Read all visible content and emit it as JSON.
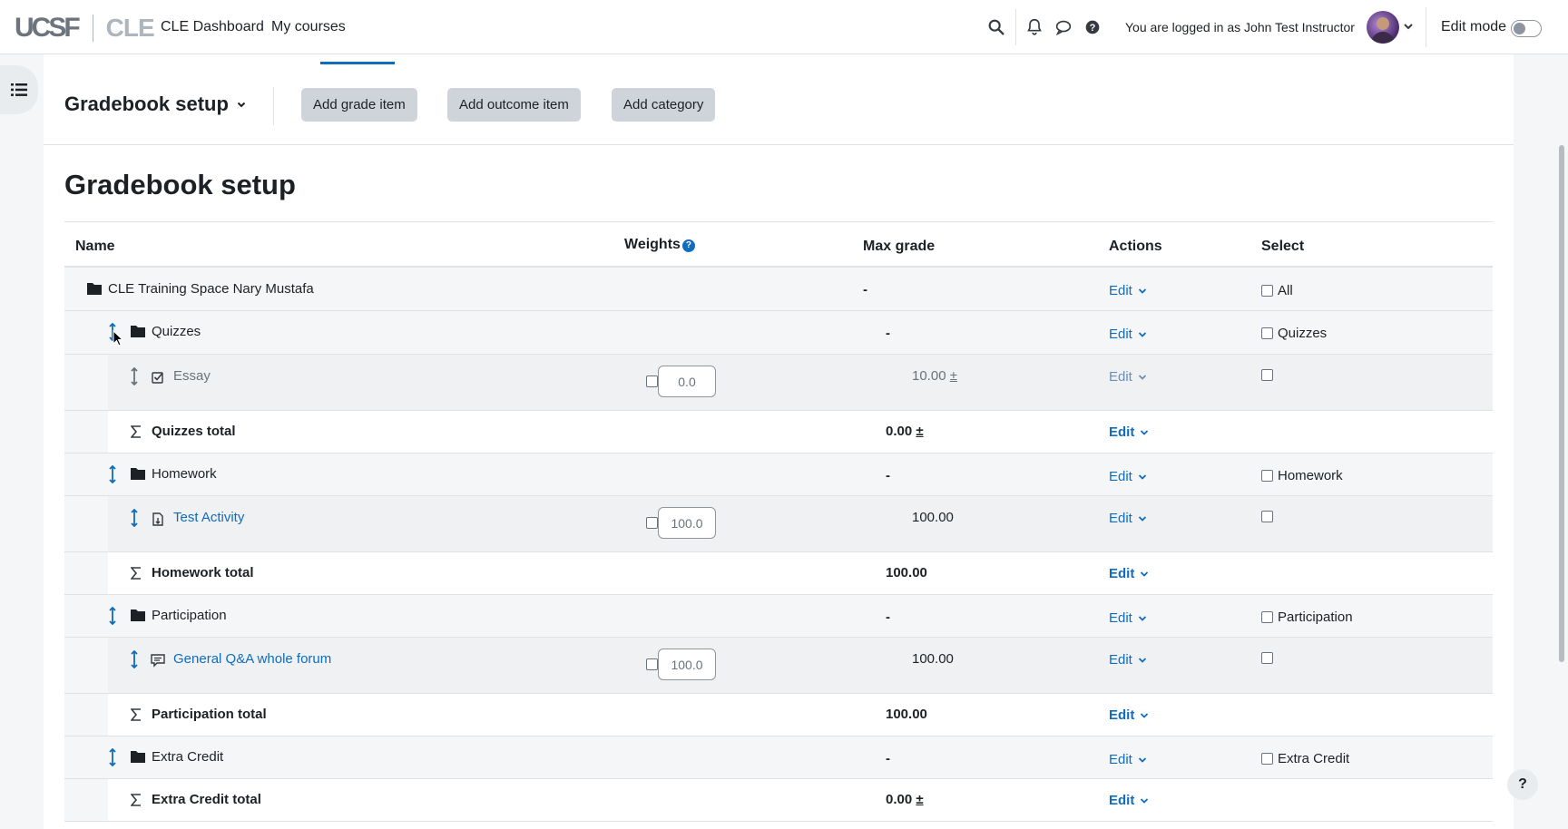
{
  "brand": {
    "ucsf": "UCSF",
    "cle": "CLE"
  },
  "nav": {
    "dashboard": "CLE Dashboard",
    "mycourses": "My courses"
  },
  "user": {
    "login_text": "You are logged in as John Test Instructor"
  },
  "editmode": {
    "label": "Edit mode"
  },
  "toolbar": {
    "select_label": "Gradebook setup",
    "add_grade_item": "Add grade item",
    "add_outcome_item": "Add outcome item",
    "add_category": "Add category"
  },
  "page_title": "Gradebook setup",
  "table": {
    "headers": {
      "name": "Name",
      "weights": "Weights",
      "max_grade": "Max grade",
      "actions": "Actions",
      "select": "Select"
    },
    "edit_label": "Edit",
    "course": {
      "name": "CLE Training Space Nary Mustafa",
      "max": "-",
      "select_label": "All"
    },
    "quizzes": {
      "name": "Quizzes",
      "max": "-",
      "select_label": "Quizzes"
    },
    "essay": {
      "name": "Essay",
      "weight": "0.0",
      "max": "10.00",
      "pm": "±"
    },
    "quizzes_total": {
      "name": "Quizzes total",
      "max": "0.00",
      "pm": "±"
    },
    "homework": {
      "name": "Homework",
      "max": "-",
      "select_label": "Homework"
    },
    "test_activity": {
      "name": "Test Activity",
      "weight": "100.0",
      "max": "100.00"
    },
    "homework_total": {
      "name": "Homework total",
      "max": "100.00"
    },
    "participation": {
      "name": "Participation",
      "max": "-",
      "select_label": "Participation"
    },
    "forum": {
      "name": "General Q&A whole forum",
      "weight": "100.0",
      "max": "100.00"
    },
    "participation_total": {
      "name": "Participation total",
      "max": "100.00"
    },
    "extra_credit": {
      "name": "Extra Credit",
      "max": "-",
      "select_label": "Extra Credit"
    },
    "extra_credit_total": {
      "name": "Extra Credit total",
      "max": "0.00",
      "pm": "±"
    }
  },
  "help_fab": "?"
}
